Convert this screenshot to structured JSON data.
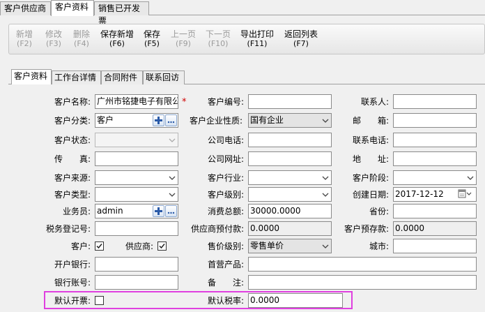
{
  "top_tabs": [
    "客户供应商",
    "客户资料",
    "销售已开发票"
  ],
  "toolbar": {
    "add": {
      "label": "新增",
      "key": "(F2)"
    },
    "edit": {
      "label": "修改",
      "key": "(F3)"
    },
    "delete": {
      "label": "删除",
      "key": "(F4)"
    },
    "save_new": {
      "label": "保存新增",
      "key": "(F6)"
    },
    "save": {
      "label": "保存",
      "key": "(F5)"
    },
    "prev": {
      "label": "上一页",
      "key": "(F9)"
    },
    "next": {
      "label": "下一页",
      "key": "(F10)"
    },
    "export": {
      "label": "导出打印",
      "key": "(F11)"
    },
    "back": {
      "label": "返回列表",
      "key": "(F7)"
    }
  },
  "sub_tabs": [
    "客户资料",
    "工作台详情",
    "合同附件",
    "联系回访"
  ],
  "form": {
    "customer_name": {
      "label": "客户名称:",
      "value": "广州市铭捷电子有限公"
    },
    "required_mark": "*",
    "customer_no": {
      "label": "客户编号:",
      "value": ""
    },
    "contact": {
      "label": "联系人:",
      "value": ""
    },
    "customer_category": {
      "label": "客户分类:",
      "value": "客户"
    },
    "company_nature": {
      "label": "客户企业性质:",
      "value": "国有企业"
    },
    "postcode": {
      "label": "邮　　箱:",
      "value": ""
    },
    "customer_status": {
      "label": "客户状态:",
      "value": ""
    },
    "company_phone": {
      "label": "公司电话:",
      "value": ""
    },
    "contact_phone": {
      "label": "联系电话:",
      "value": ""
    },
    "fax": {
      "label": "传　　真:",
      "value": ""
    },
    "company_website": {
      "label": "公司网址:",
      "value": ""
    },
    "address": {
      "label": "地　　址:",
      "value": ""
    },
    "customer_source": {
      "label": "客户来源:",
      "value": ""
    },
    "customer_industry": {
      "label": "客户行业:",
      "value": ""
    },
    "customer_stage": {
      "label": "客户阶段:",
      "value": ""
    },
    "customer_type": {
      "label": "客户类型:",
      "value": ""
    },
    "customer_level": {
      "label": "客户级别:",
      "value": ""
    },
    "created_date": {
      "label": "创建日期:",
      "value": "2017-12-12"
    },
    "salesman": {
      "label": "业务员:",
      "value": "admin"
    },
    "total_spend": {
      "label": "消费总额:",
      "value": "30000.0000"
    },
    "province": {
      "label": "省份:",
      "value": ""
    },
    "tax_reg_no": {
      "label": "税务登记号:",
      "value": ""
    },
    "supplier_prepay": {
      "label": "供应商预付款:",
      "value": "0.0000"
    },
    "customer_prepay": {
      "label": "客户预存款:",
      "value": "0.0000"
    },
    "is_customer": {
      "label": "客户:"
    },
    "is_supplier": {
      "label": "供应商:"
    },
    "price_level": {
      "label": "售价级别:",
      "value": "零售单价"
    },
    "city": {
      "label": "城市:",
      "value": ""
    },
    "bank": {
      "label": "开户银行:",
      "value": ""
    },
    "first_product": {
      "label": "首营产品:",
      "value": ""
    },
    "bank_account": {
      "label": "银行账号:",
      "value": ""
    },
    "remark": {
      "label": "备　　注:",
      "value": ""
    },
    "default_invoice": {
      "label": "默认开票:"
    },
    "default_tax_rate": {
      "label": "默认税率:",
      "value": "0.0000"
    }
  },
  "colors": {
    "highlight": "#e040e0",
    "required": "#d00000"
  }
}
